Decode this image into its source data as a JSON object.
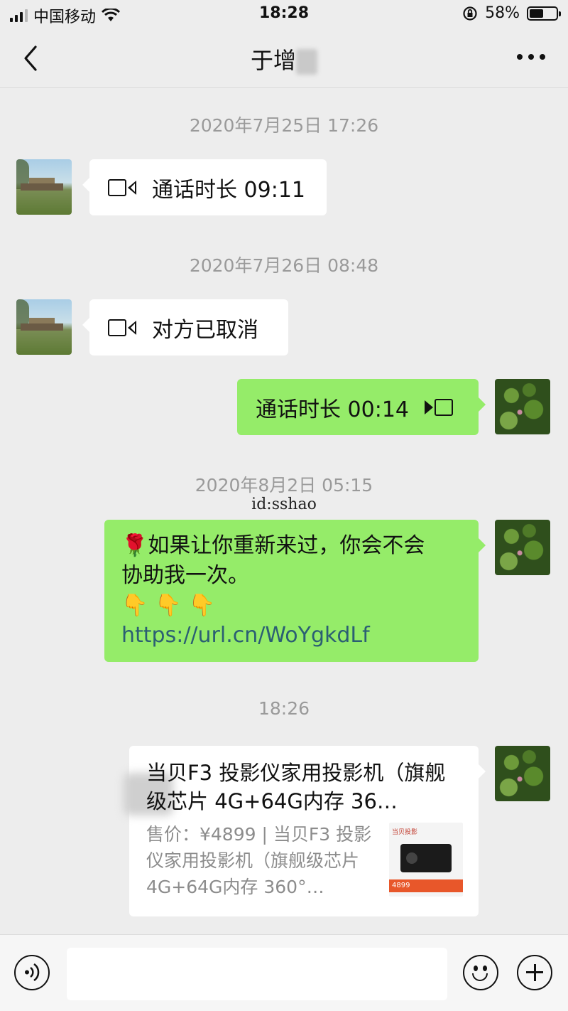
{
  "status_bar": {
    "carrier": "中国移动",
    "time": "18:28",
    "battery_percent": "58%",
    "battery_level": 0.58
  },
  "nav": {
    "title": "于增",
    "back_icon": "chevron-left-icon",
    "more_icon": "more-dots-icon"
  },
  "messages": [
    {
      "type": "timestamp",
      "text": "2020年7月25日 17:26"
    },
    {
      "type": "call",
      "side": "in",
      "text": "通话时长 09:11",
      "icon": "video-call-icon"
    },
    {
      "type": "timestamp",
      "text": "2020年7月26日 08:48"
    },
    {
      "type": "call",
      "side": "in",
      "text": "对方已取消",
      "icon": "video-call-icon"
    },
    {
      "type": "call",
      "side": "out",
      "text": "通话时长 00:14",
      "icon": "video-call-icon"
    },
    {
      "type": "timestamp",
      "text": "2020年8月2日 05:15"
    },
    {
      "type": "text",
      "side": "out",
      "line1": "如果让你重新来过，你会不会",
      "line2": "协助我一次。",
      "rose": "🌹",
      "hands": "👇👇👇",
      "link": "https://url.cn/WoYgkdLf"
    },
    {
      "type": "timestamp",
      "text": "18:26"
    },
    {
      "type": "card",
      "side": "out",
      "title": "当贝F3 投影仪家用投影机（旗舰级芯片 4G+64G内存 36…",
      "desc": "售价：¥4899 | 当贝F3 投影仪家用投影机（旗舰级芯片 4G+64G内存 360°…",
      "thumb_brand": "当贝投影",
      "thumb_price": "4899"
    }
  ],
  "overlay_id": "id:sshao",
  "input_bar": {
    "placeholder": "",
    "voice_icon": "voice-icon",
    "emoji_icon": "emoji-icon",
    "plus_icon": "plus-icon"
  },
  "colors": {
    "background": "#ededed",
    "outgoing_bubble": "#95ec69",
    "incoming_bubble": "#ffffff",
    "timestamp": "#9a9a9a",
    "link": "#2b5f73"
  }
}
